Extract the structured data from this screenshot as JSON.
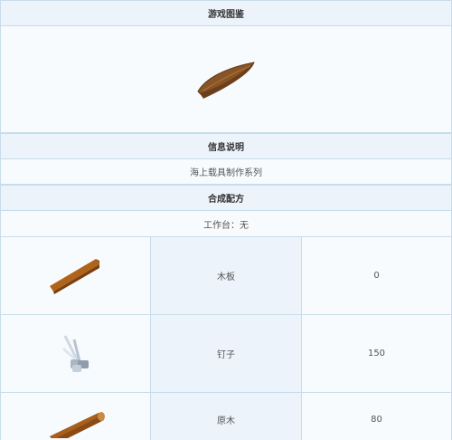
{
  "title": "游戏图鉴",
  "item": {
    "icon": "wooden-boat-icon"
  },
  "info_header": "信息说明",
  "info_text": "海上载具制作系列",
  "recipe_header": "合成配方",
  "workbench_text": "工作台：无",
  "ingredients": [
    {
      "icon": "wooden-plank-icon",
      "name": "木板",
      "qty": "0"
    },
    {
      "icon": "nails-icon",
      "name": "钉子",
      "qty": "150"
    },
    {
      "icon": "log-icon",
      "name": "原木",
      "qty": "80"
    }
  ],
  "colors": {
    "border": "#c7dcea",
    "header_bg": "#edf3fa",
    "cell_bg": "#f8fbfe",
    "wood": "#b0631a",
    "boat": "#8a5526"
  }
}
